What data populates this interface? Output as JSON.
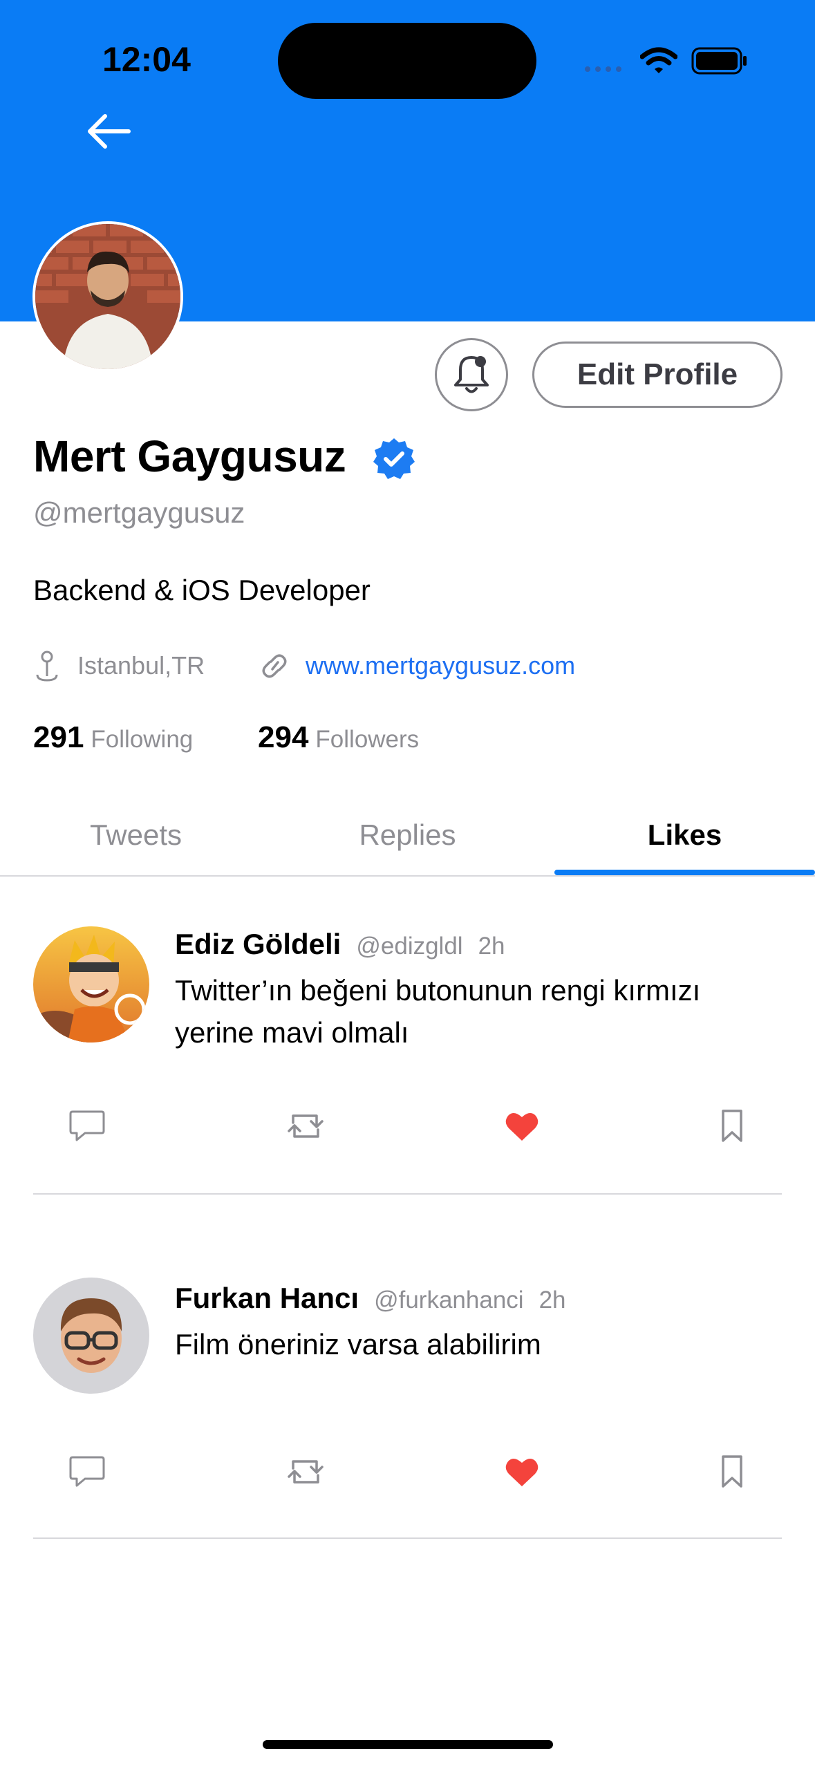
{
  "colors": {
    "accent": "#0a7cf5",
    "like": "#f4433c",
    "secondary_text": "#8e8e93",
    "link": "#1d6ff2"
  },
  "status_bar": {
    "time": "12:04",
    "icons": [
      "cellular-icon",
      "wifi-icon",
      "battery-icon"
    ]
  },
  "nav": {
    "back_icon": "arrow-left-icon"
  },
  "profile": {
    "name": "Mert Gaygusuz",
    "verified": true,
    "handle": "@mertgaygusuz",
    "bio": "Backend & iOS Developer",
    "location": "Istanbul,TR",
    "website": "www.mertgaygusuz.com",
    "following_count": "291",
    "following_label": "Following",
    "followers_count": "294",
    "followers_label": "Followers",
    "edit_profile_label": "Edit Profile"
  },
  "tabs": [
    {
      "label": "Tweets",
      "active": false
    },
    {
      "label": "Replies",
      "active": false
    },
    {
      "label": "Likes",
      "active": true
    }
  ],
  "tweets": [
    {
      "name": "Ediz Göldeli",
      "handle": "@edizgldl",
      "time": "2h",
      "text": "Twitter’ın beğeni butonunun rengi kırmızı yerine mavi olmalı",
      "liked": true
    },
    {
      "name": "Furkan Hancı",
      "handle": "@furkanhanci",
      "time": "2h",
      "text": "Film öneriniz varsa alabilirim",
      "liked": true
    }
  ]
}
